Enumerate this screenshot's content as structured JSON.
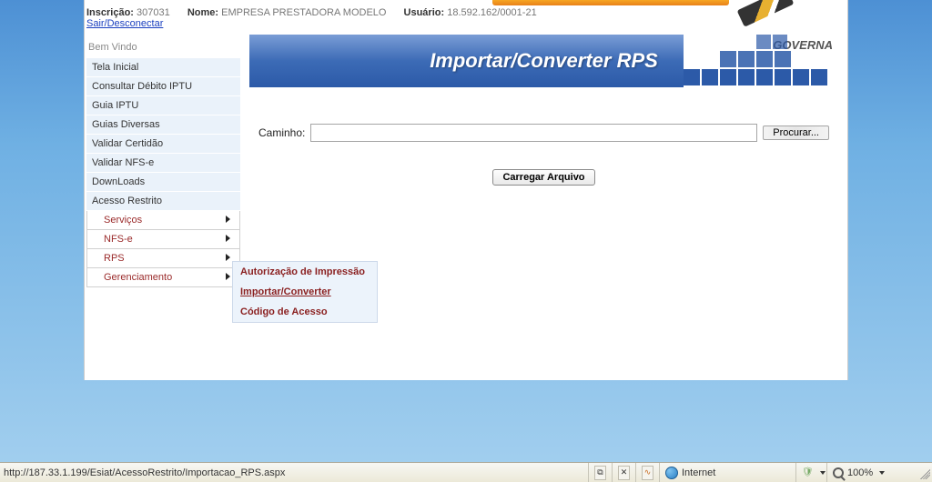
{
  "info": {
    "inscricao_label": "Inscrição:",
    "inscricao_value": "307031",
    "nome_label": "Nome:",
    "nome_value": "EMPRESA PRESTADORA MODELO",
    "usuario_label": "Usuário:",
    "usuario_value": "18.592.162/0001-21",
    "disconnect": "Sair/Desconectar"
  },
  "sidebar": {
    "welcome": "Bem Vindo",
    "items": [
      "Tela Inicial",
      "Consultar Débito IPTU",
      "Guia IPTU",
      "Guias Diversas",
      "Validar Certidão",
      "Validar NFS-e",
      "DownLoads",
      "Acesso Restrito"
    ],
    "subitems": [
      "Serviços",
      "NFS-e",
      "RPS",
      "Gerenciamento"
    ]
  },
  "banner": {
    "title": "Importar/Converter RPS",
    "brand": "GOVERNA"
  },
  "form": {
    "path_label": "Caminho:",
    "browse_label": "Procurar...",
    "load_label": "Carregar Arquivo"
  },
  "flyout": {
    "items": [
      "Autorização de Impressão",
      "Importar/Converter",
      "Código de Acesso"
    ],
    "active_index": 1
  },
  "statusbar": {
    "url": "http://187.33.1.199/Esiat/AcessoRestrito/Importacao_RPS.aspx",
    "zone": "Internet",
    "zoom": "100%"
  }
}
